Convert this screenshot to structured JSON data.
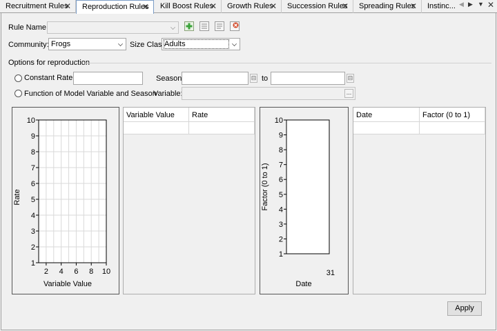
{
  "tabs": [
    {
      "label": "Recruitment Rules",
      "active": false,
      "closable": true
    },
    {
      "label": "Reproduction Rules",
      "active": true,
      "closable": true
    },
    {
      "label": "Kill Boost Rules",
      "active": false,
      "closable": true
    },
    {
      "label": "Growth Rules",
      "active": false,
      "closable": true
    },
    {
      "label": "Succession Rules",
      "active": false,
      "closable": true
    },
    {
      "label": "Spreading Rules",
      "active": false,
      "closable": true
    },
    {
      "label": "Instinc...",
      "active": false,
      "closable": false
    }
  ],
  "tab_nav": {
    "prev_icon": "triangle-left-icon",
    "next_icon": "triangle-right-icon",
    "menu_icon": "triangle-down-icon",
    "close_glyph": "✕"
  },
  "form": {
    "rule_name_label": "Rule Name:",
    "rule_name_value": "",
    "toolbar": [
      "add-rule-icon",
      "list-icon",
      "list-alt-icon",
      "delete-rule-icon"
    ],
    "community_label": "Community:",
    "community_value": "Frogs",
    "size_class_label": "Size Class:",
    "size_class_value": "Adults",
    "options_heading": "Options for reproduction",
    "constant_rate_label": "Constant Rate:",
    "constant_rate_value": "",
    "season_label": "Season:",
    "season_from": "",
    "to_label": "to",
    "season_to": "",
    "function_label": "Function of Model Variable and Season",
    "variable_label": "Variable:",
    "variable_value": "",
    "browse_glyph": "...",
    "spin_glyph": "⊟"
  },
  "rate_grid": {
    "headers": [
      "Variable Value",
      "Rate"
    ]
  },
  "factor_grid": {
    "headers": [
      "Date",
      "Factor (0 to 1)"
    ]
  },
  "apply_label": "Apply",
  "chart_data": [
    {
      "type": "line",
      "title": "",
      "xlabel": "Variable Value",
      "ylabel": "Rate",
      "xlim": [
        1,
        10
      ],
      "ylim": [
        1,
        10
      ],
      "x_ticks": [
        "2",
        "4",
        "6",
        "8",
        "10"
      ],
      "y_ticks": [
        "1",
        "2",
        "3",
        "4",
        "5",
        "6",
        "7",
        "8",
        "9",
        "10"
      ],
      "grid": true,
      "series": []
    },
    {
      "type": "line",
      "title": "",
      "xlabel": "Date",
      "ylabel": "Factor (0 to 1)",
      "ylim": [
        1,
        10
      ],
      "x_ticks": [
        "31"
      ],
      "y_ticks": [
        "1",
        "2",
        "3",
        "4",
        "5",
        "6",
        "7",
        "8",
        "9",
        "10"
      ],
      "grid": false,
      "series": []
    }
  ]
}
